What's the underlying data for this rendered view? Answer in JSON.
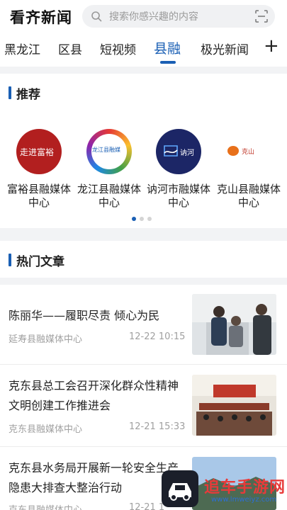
{
  "header": {
    "app_title": "看齐新闻",
    "search_placeholder": "搜索你感兴趣的内容"
  },
  "tabs": [
    {
      "label": "黑龙江"
    },
    {
      "label": "区县"
    },
    {
      "label": "短视频"
    },
    {
      "label": "县融",
      "active": true
    },
    {
      "label": "极光新闻"
    }
  ],
  "recommend": {
    "title": "推荐",
    "items": [
      {
        "name": "富裕县融媒体中心",
        "logo_text": "走进富裕",
        "logo_bg": "#b21f1f"
      },
      {
        "name": "龙江县融媒体中心",
        "logo_text": "龙江县融媒",
        "logo_bg": "#ffffff"
      },
      {
        "name": "讷河市融媒体中心",
        "logo_text": "讷河",
        "logo_bg": "#1c2666"
      },
      {
        "name": "克山县融媒体中心",
        "logo_text": "克山",
        "logo_bg": "#ffffff"
      }
    ],
    "page_count": 3,
    "active_page": 0
  },
  "hot": {
    "title": "热门文章",
    "articles": [
      {
        "title": "陈丽华——履职尽责 倾心为民",
        "source": "延寿县融媒体中心",
        "time": "12-22 10:15"
      },
      {
        "title": "克东县总工会召开深化群众性精神文明创建工作推进会",
        "source": "克东县融媒体中心",
        "time": "12-21 15:33"
      },
      {
        "title": "克东县水务局开展新一轮安全生产隐患大排查大整治行动",
        "source": "克东县融媒体中心",
        "time": "12-21 1"
      }
    ]
  },
  "watermark": {
    "text": "追车手游网",
    "url": "www.lmweiyz.com"
  },
  "colors": {
    "accent": "#1a5fb4",
    "watermark_red": "#e83a3a"
  }
}
